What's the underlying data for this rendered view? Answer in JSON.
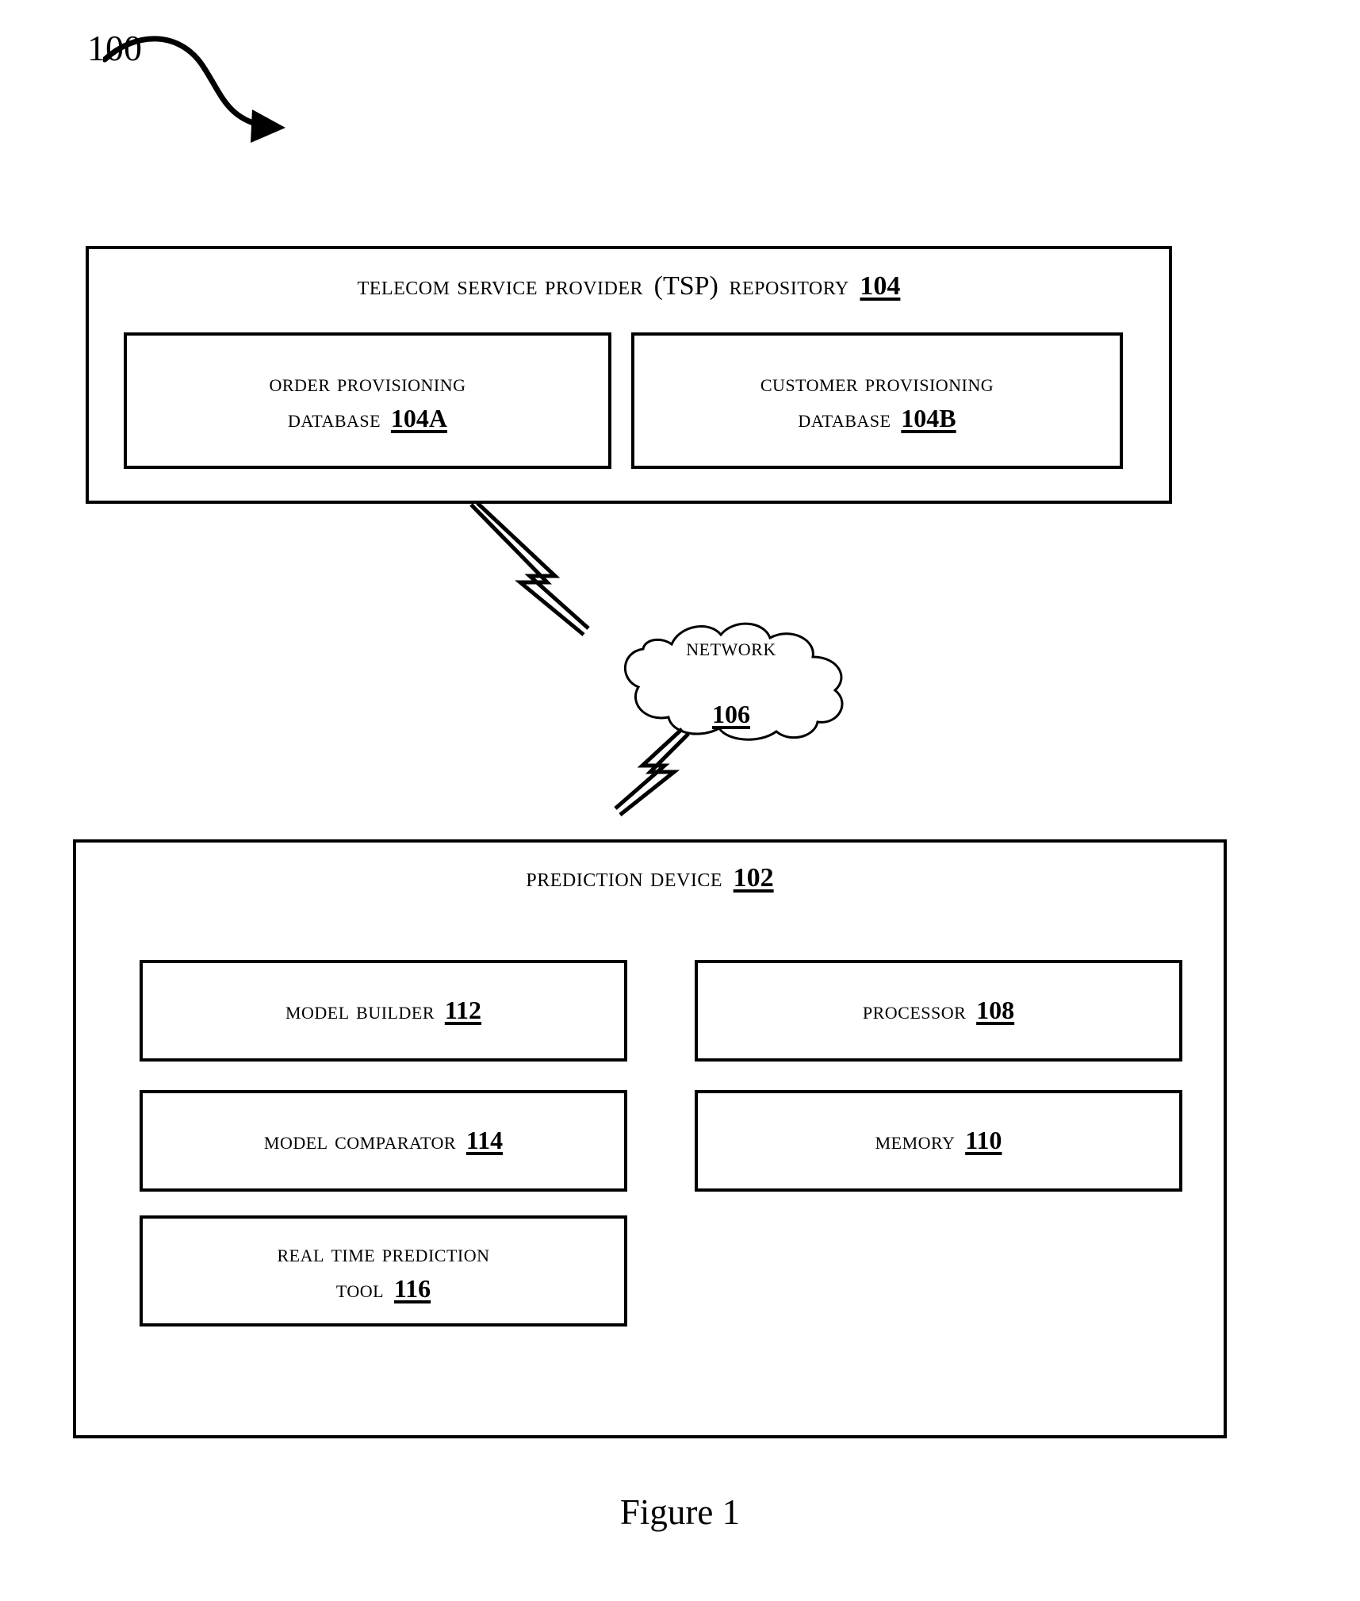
{
  "figure": {
    "reference_number": "100",
    "caption": "Figure 1"
  },
  "tsp_repository": {
    "title_text": "Telecom Service Provider",
    "title_abbrev": "(TSP)",
    "title_suffix": "Repository",
    "ref": "104",
    "databases": [
      {
        "line1": "Order Provisioning",
        "line2": "Database",
        "ref": "104A"
      },
      {
        "line1": "Customer Provisioning",
        "line2": "Database",
        "ref": "104B"
      }
    ]
  },
  "network": {
    "label": "Network",
    "ref": "106"
  },
  "prediction_device": {
    "title": "Prediction Device",
    "ref": "102",
    "left_components": [
      {
        "label": "Model Builder",
        "ref": "112"
      },
      {
        "label": "Model Comparator",
        "ref": "114"
      },
      {
        "label_line1": "Real time Prediction",
        "label_line2": "Tool",
        "ref": "116"
      }
    ],
    "right_components": [
      {
        "label": "Processor",
        "ref": "108"
      },
      {
        "label": "Memory",
        "ref": "110"
      }
    ]
  },
  "style": {
    "stroke_color": "#000000",
    "background_color": "#ffffff"
  }
}
